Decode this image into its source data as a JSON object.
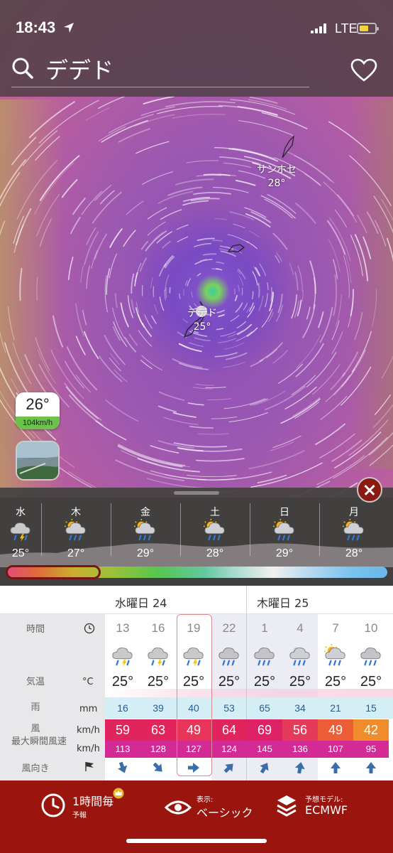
{
  "status": {
    "time": "18:43",
    "network": "LTE"
  },
  "search": {
    "query": "デデド"
  },
  "map": {
    "cities": [
      {
        "name": "サンホセ",
        "temp": "28°"
      },
      {
        "name": "デデド",
        "temp": "25°"
      }
    ],
    "badge": {
      "temp": "26°",
      "wind": "104km/h"
    }
  },
  "daily": [
    {
      "day": "水",
      "temp": "25°",
      "icon": "thunderstorm-icon"
    },
    {
      "day": "木",
      "temp": "27°",
      "icon": "sun-rain-cloud-icon"
    },
    {
      "day": "金",
      "temp": "29°",
      "icon": "sun-rain-cloud-icon"
    },
    {
      "day": "土",
      "temp": "28°",
      "icon": "sun-rain-cloud-icon"
    },
    {
      "day": "日",
      "temp": "29°",
      "icon": "sun-rain-cloud-icon"
    },
    {
      "day": "月",
      "temp": "28°",
      "icon": "sun-rain-cloud-icon"
    }
  ],
  "hourly": {
    "day_headers": [
      "水曜日 24",
      "木曜日 25"
    ],
    "row_labels": {
      "time": "時間",
      "temp": "気温",
      "temp_unit": "°C",
      "rain": "雨",
      "rain_unit": "mm",
      "wind": "風",
      "wind_unit": "km/h",
      "gust": "最大瞬間風速",
      "gust_unit": "km/h",
      "direction": "風向き"
    },
    "columns": [
      {
        "hour": "13",
        "icon": "thunderstorm-icon",
        "temp": "25°",
        "rain": "16",
        "wind": "59",
        "gust": "113",
        "dir": 160,
        "wind_color": "#e2245d"
      },
      {
        "hour": "16",
        "icon": "thunderstorm-icon",
        "temp": "25°",
        "rain": "39",
        "wind": "63",
        "gust": "128",
        "dir": 135,
        "wind_color": "#e2245d"
      },
      {
        "hour": "19",
        "icon": "thunderstorm-icon",
        "temp": "25°",
        "rain": "40",
        "wind": "49",
        "gust": "127",
        "dir": 90,
        "wind_color": "#e9355a"
      },
      {
        "hour": "22",
        "icon": "heavy-rain-icon",
        "temp": "25°",
        "rain": "53",
        "wind": "64",
        "gust": "124",
        "dir": 45,
        "wind_color": "#e2245d"
      },
      {
        "hour": "1",
        "icon": "heavy-rain-icon",
        "temp": "25°",
        "rain": "65",
        "wind": "69",
        "gust": "145",
        "dir": 30,
        "wind_color": "#df2266"
      },
      {
        "hour": "4",
        "icon": "moon-rain-icon",
        "temp": "25°",
        "rain": "34",
        "wind": "56",
        "gust": "136",
        "dir": 10,
        "wind_color": "#e63a5a"
      },
      {
        "hour": "7",
        "icon": "sun-rain-cloud-icon",
        "temp": "25°",
        "rain": "21",
        "wind": "49",
        "gust": "107",
        "dir": 0,
        "wind_color": "#ec5d38"
      },
      {
        "hour": "10",
        "icon": "heavy-rain-icon",
        "temp": "25°",
        "rain": "15",
        "wind": "42",
        "gust": "95",
        "dir": 0,
        "wind_color": "#ef8d2c"
      }
    ]
  },
  "bottom": {
    "interval_label": "1時間毎",
    "interval_sub": "予報",
    "view_sub": "表示:",
    "view_label": "ベーシック",
    "model_sub": "予想モデル:",
    "model_label": "ECMWF"
  },
  "colors": {
    "bottom_bar": "#9a150e",
    "gust_row": "#d32a96"
  }
}
